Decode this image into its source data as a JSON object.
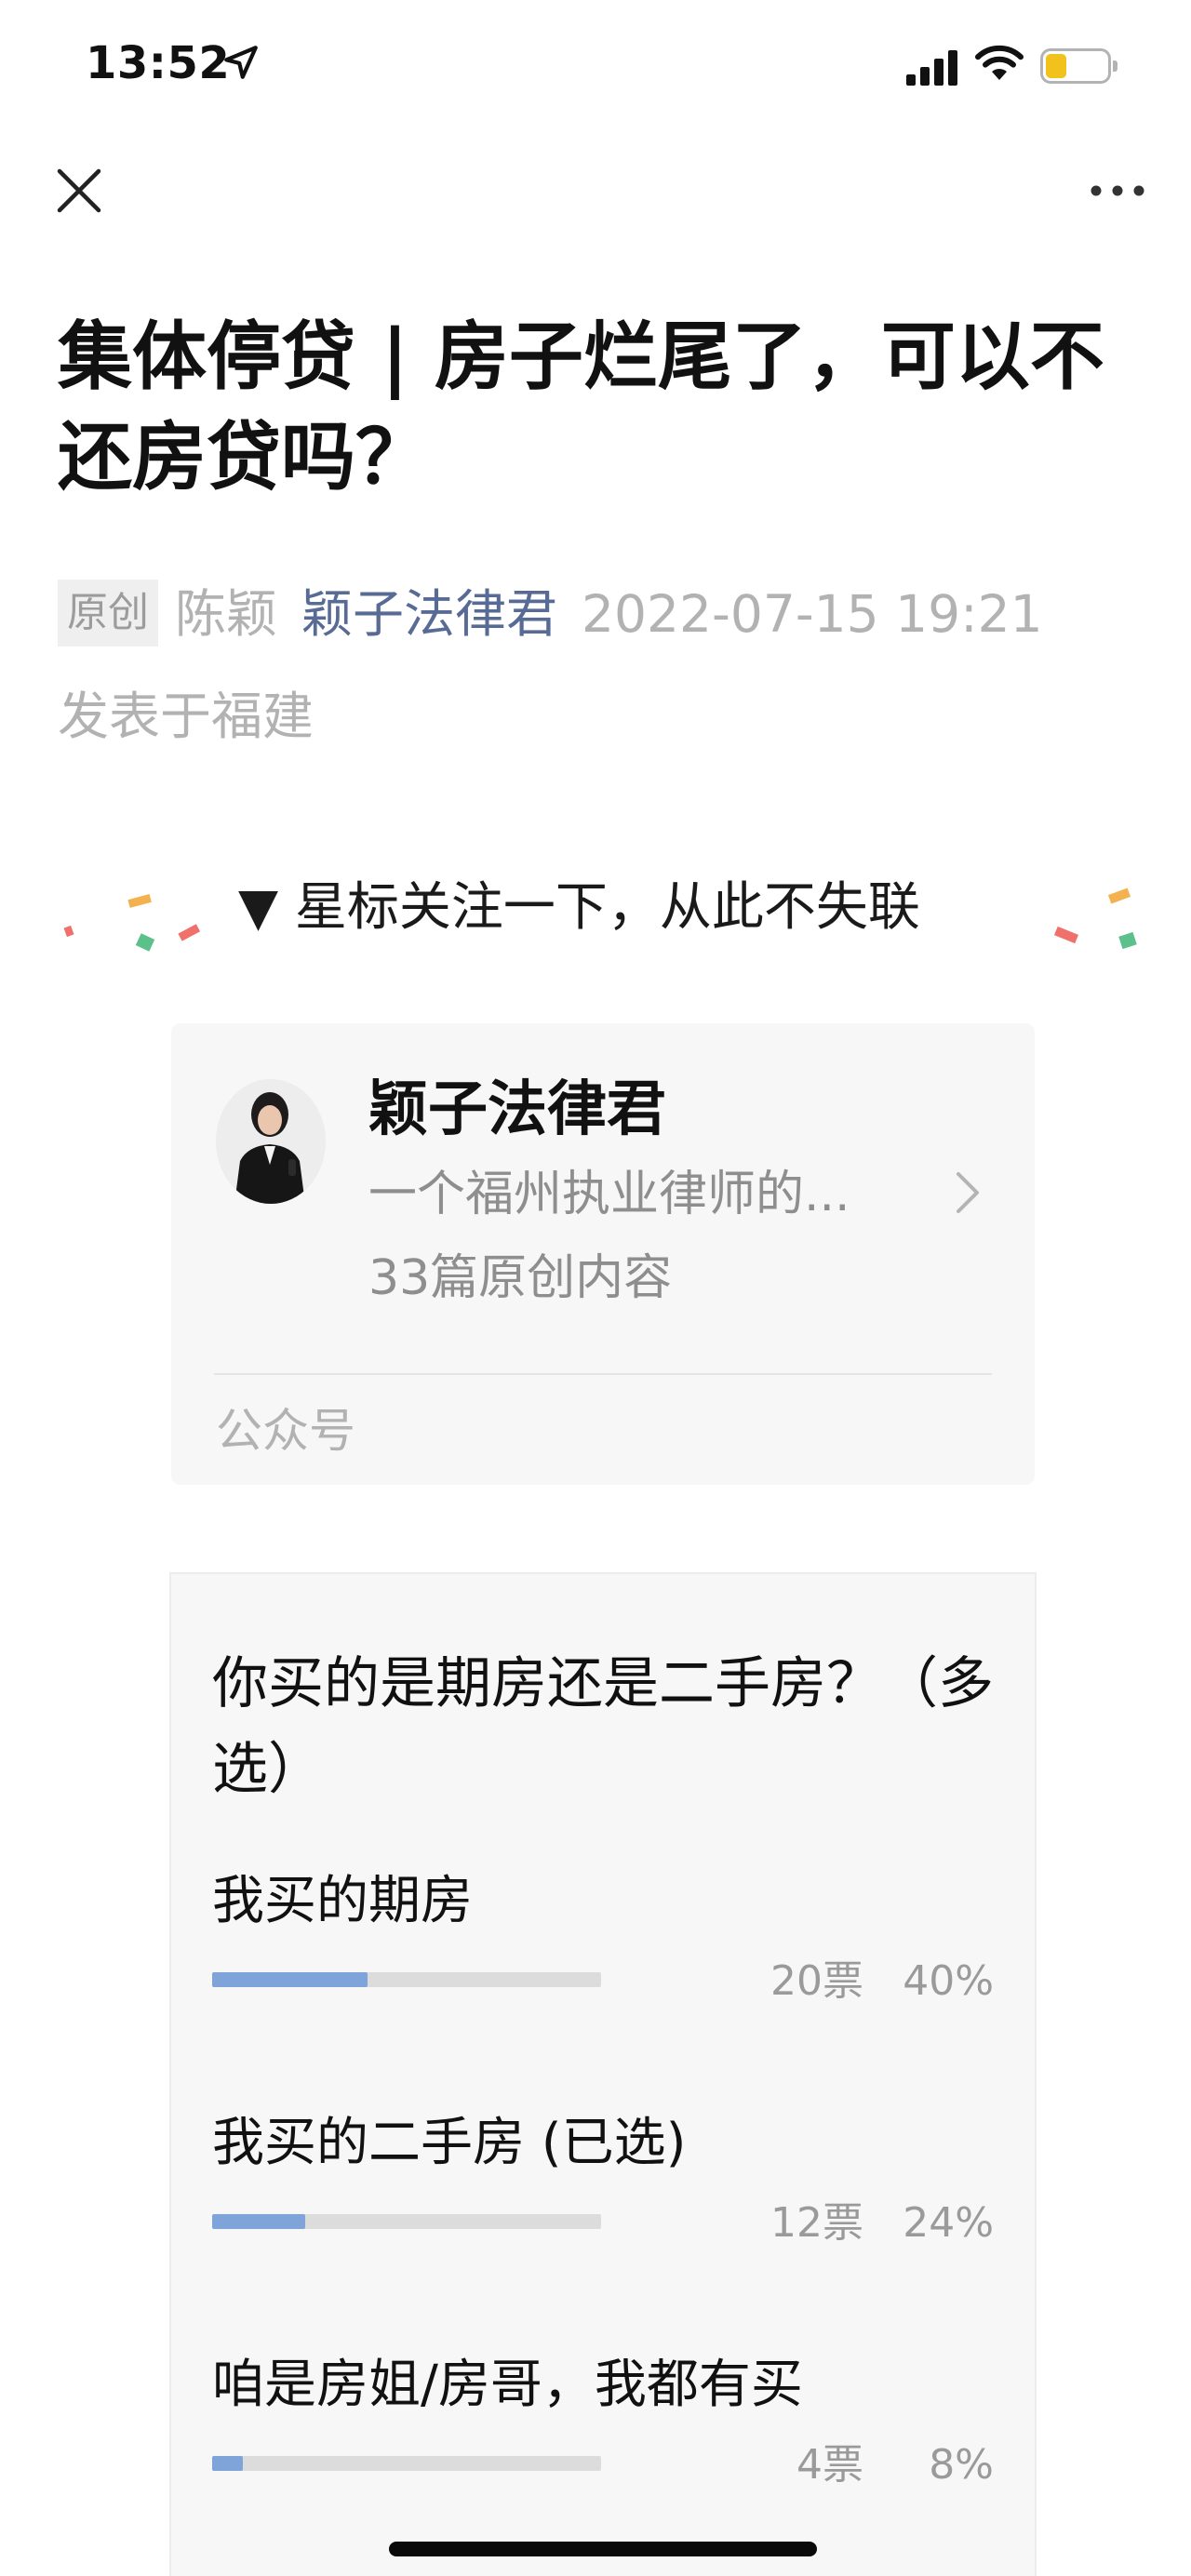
{
  "status_bar": {
    "time": "13:52",
    "battery_color": "#f1c21b"
  },
  "nav": {
    "close_icon": "close-icon",
    "more_icon": "more-icon"
  },
  "article": {
    "title": "集体停贷 | 房子烂尾了，可以不还房贷吗？",
    "tag": "原创",
    "author": "陈颖",
    "account": "颖子法律君",
    "datetime": "2022-07-15 19:21",
    "location": "发表于福建",
    "account_color": "#576b95"
  },
  "banner": {
    "text": "▼ 星标关注一下，从此不失联"
  },
  "profile_card": {
    "name": "颖子法律君",
    "description": "一个福州执业律师的...",
    "count": "33篇原创内容",
    "type": "公众号"
  },
  "vote": {
    "question": "你买的是期房还是二手房？（多选）",
    "options": [
      {
        "label": "我买的期房",
        "votes": "20票",
        "percent": "40%",
        "fraction": 0.4
      },
      {
        "label": "我买的二手房 (已选)",
        "votes": "12票",
        "percent": "24%",
        "fraction": 0.24
      },
      {
        "label": "咱是房姐/房哥，我都有买",
        "votes": "4票",
        "percent": "8%",
        "fraction": 0.08
      }
    ],
    "bar_color": "#7fa4d9"
  }
}
